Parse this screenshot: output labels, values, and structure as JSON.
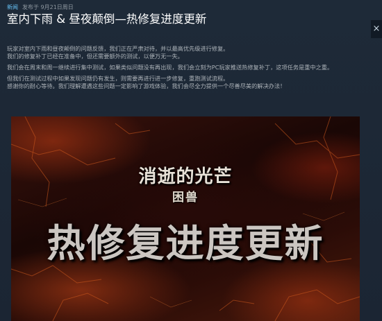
{
  "meta": {
    "tag": "新闻",
    "posted": "发布于 9月21日周日"
  },
  "title": "室内下雨 & 昼夜颠倒—热修复进度更新",
  "close_icon": "×",
  "paragraphs": [
    "玩家对室内下雨和昼夜颠倒的问题反馈，我们正在严肃对待，并以最高优先级进行修复。",
    "我们的修复补丁已经在准备中，但还需要额外的测试，以便万无一失。",
    "我们会在周末和周一继续进行集中测试，如果类似问题没有再出现，我们会立刻为PC玩家推送热修复补丁，这项任务是重中之重。",
    "但我们在测试过程中如果发现问题仍有发生，则需要再进行进一步修复，重跑测试流程。",
    "感谢你的耐心等待。我们理解遭遇这些问题一定影响了游戏体验，我们会尽全力提供一个尽善尽美的解决办法！"
  ],
  "banner": {
    "logo_main": "消逝的光芒",
    "logo_sub": "困兽",
    "headline": "热修复进度更新"
  }
}
